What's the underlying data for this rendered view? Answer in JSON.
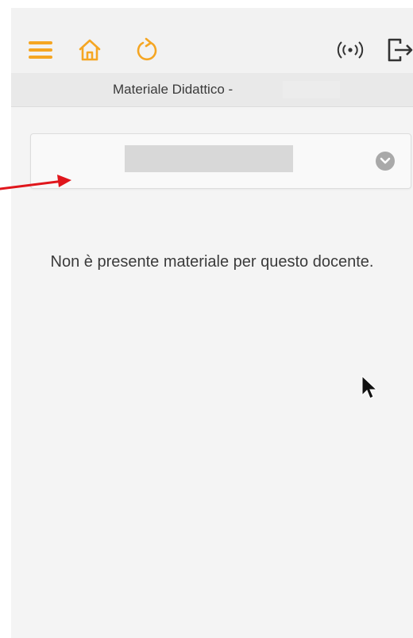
{
  "header": {
    "icons": [
      "menu-icon",
      "home-icon",
      "refresh-icon",
      "radio-signal-icon",
      "logout-icon"
    ],
    "subtitle": "Materiale Didattico -"
  },
  "selector": {
    "value": "",
    "icon": "chevron-down-icon"
  },
  "main": {
    "empty_message": "Non è presente materiale per questo docente."
  },
  "colors": {
    "accent": "#F5A623",
    "annotation": "#E0161C"
  }
}
